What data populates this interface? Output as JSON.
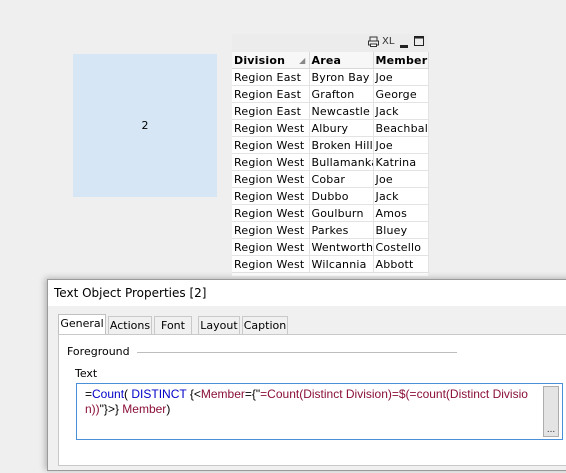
{
  "text_object": {
    "value": "2"
  },
  "table": {
    "caption_icons": [
      "print-icon",
      "excel-icon",
      "minimize-icon",
      "maximize-icon"
    ],
    "caption_xl": "XL",
    "columns": [
      "Division",
      "Area",
      "Member"
    ],
    "rows": [
      [
        "Region East",
        "Byron Bay",
        "Joe"
      ],
      [
        "Region East",
        "Grafton",
        "George"
      ],
      [
        "Region East",
        "Newcastle",
        "Jack"
      ],
      [
        "Region West",
        "Albury",
        "Beachball"
      ],
      [
        "Region West",
        "Broken Hill",
        "Joe"
      ],
      [
        "Region West",
        "Bullamanka",
        "Katrina"
      ],
      [
        "Region West",
        "Cobar",
        "Joe"
      ],
      [
        "Region West",
        "Dubbo",
        "Jack"
      ],
      [
        "Region West",
        "Goulburn",
        "Amos"
      ],
      [
        "Region West",
        "Parkes",
        "Bluey"
      ],
      [
        "Region West",
        "Wentworth",
        "Costello"
      ],
      [
        "Region West",
        "Wilcannia",
        "Abbott"
      ]
    ]
  },
  "dialog": {
    "title": "Text Object Properties [2]",
    "tabs": [
      "General",
      "Actions",
      "Font",
      "Layout",
      "Caption"
    ],
    "active_tab": "General",
    "foreground_label": "Foreground",
    "text_label": "Text",
    "expression": {
      "p1": "=",
      "p2": "Count",
      "p3": "( ",
      "p4": "DISTINCT",
      "p5": " {<",
      "p6": "Member",
      "p7": "={\"",
      "p8": "=Count(Distinct Division)=$(=count(Distinct Division))",
      "p9": "\"}>} ",
      "p10": "Member",
      "p11": ")"
    },
    "ellipsis": "..."
  },
  "colors": {
    "text_object_bg": "#d6e6f5",
    "expr_function": "#0000c8",
    "expr_field": "#8a0f3a"
  }
}
